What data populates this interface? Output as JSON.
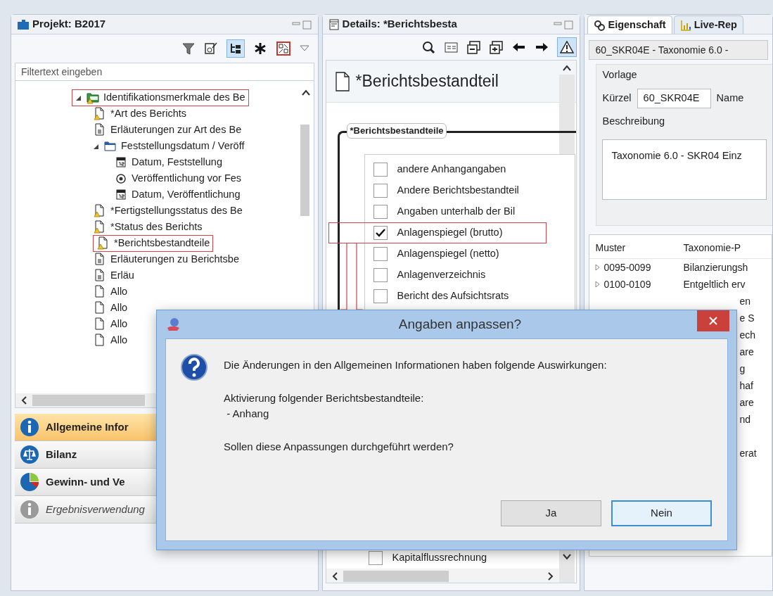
{
  "project_panel": {
    "title": "Projekt: B2017",
    "filter": {
      "placeholder": "Filtertext eingeben"
    },
    "tree": [
      {
        "label": "Identifikationsmerkmale des Be",
        "kind": "folder-green",
        "warning": true,
        "expanded": true,
        "marked": true,
        "children": [
          {
            "label": "*Art des Berichts",
            "kind": "doc",
            "warning": true,
            "marked": false
          },
          {
            "label": "Erläuterungen zur Art des Be",
            "kind": "doc-text",
            "warning": false,
            "marked": false
          },
          {
            "label": "Feststellungsdatum / Veröff",
            "kind": "folder",
            "warning": false,
            "expanded": true,
            "marked": false,
            "children": [
              {
                "label": "Datum, Feststellung",
                "kind": "calendar",
                "warning": false,
                "marked": false
              },
              {
                "label": "Veröffentlichung vor Fes",
                "kind": "radio",
                "warning": false,
                "marked": false
              },
              {
                "label": "Datum, Veröffentlichung",
                "kind": "calendar",
                "warning": false,
                "marked": false
              }
            ]
          },
          {
            "label": "*Fertigstellungsstatus des Be",
            "kind": "doc",
            "warning": true,
            "marked": false
          },
          {
            "label": "*Status des Berichts",
            "kind": "doc",
            "warning": true,
            "marked": false
          },
          {
            "label": "*Berichtsbestandteile",
            "kind": "doc",
            "warning": true,
            "marked": true
          },
          {
            "label": "Erläuterungen zu Berichtsbe",
            "kind": "doc-text",
            "warning": false,
            "marked": false
          },
          {
            "label": "Erläu",
            "kind": "doc-text",
            "warning": false,
            "marked": false
          },
          {
            "label": "Allo",
            "kind": "doc",
            "warning": false,
            "marked": false
          },
          {
            "label": "Allo",
            "kind": "doc",
            "warning": false,
            "marked": false
          },
          {
            "label": "Allo",
            "kind": "doc",
            "warning": false,
            "marked": false
          },
          {
            "label": "Allo",
            "kind": "doc",
            "warning": false,
            "marked": false
          }
        ]
      }
    ],
    "sections": [
      {
        "label": "Allgemeine Infor",
        "kind": "info",
        "selected": true,
        "disabled": false
      },
      {
        "label": "Bilanz",
        "kind": "scale",
        "selected": false,
        "disabled": false
      },
      {
        "label": "Gewinn- und Ve",
        "kind": "pie",
        "selected": false,
        "disabled": false
      },
      {
        "label": "Ergebnisverwendung",
        "kind": "info",
        "selected": false,
        "disabled": true
      }
    ]
  },
  "details_panel": {
    "title": "Details: *Berichtsbesta",
    "heading": "*Berichtsbestandteil",
    "group_title": "*Berichtsbestandteile",
    "items": [
      {
        "label": "andere Anhangangaben",
        "checked": false,
        "marked": false
      },
      {
        "label": "Andere Berichtsbestandteil",
        "checked": false,
        "marked": false
      },
      {
        "label": "Angaben unterhalb der Bil",
        "checked": false,
        "marked": false
      },
      {
        "label": "Anlagenspiegel (brutto)",
        "checked": true,
        "marked": true
      },
      {
        "label": "Anlagenspiegel (netto)",
        "checked": false,
        "marked": false
      },
      {
        "label": "Anlagenverzeichnis",
        "checked": false,
        "marked": false
      },
      {
        "label": "Bericht des Aufsichtsrats",
        "checked": false,
        "marked": false
      }
    ],
    "last_item": {
      "label": "Kapitalflussrechnung",
      "checked": false
    }
  },
  "properties_panel": {
    "tabs": [
      {
        "label": "Eigenschaft",
        "selected": true
      },
      {
        "label": "Live-Rep",
        "selected": false
      }
    ],
    "template_select": "60_SKR04E - Taxonomie 6.0 -",
    "group_title": "Vorlage",
    "short_label": "Kürzel",
    "short_value": "60_SKR04E",
    "name_label": "Name",
    "description_label": "Beschreibung",
    "description_value": "Taxonomie 6.0 - SKR04 Einz",
    "table": {
      "columns": [
        "Muster",
        "Taxonomie-P"
      ],
      "rows": [
        {
          "pattern": "0095-0099",
          "name": "Bilanzierungsh"
        },
        {
          "pattern": "0100-0109",
          "name": "Entgeltlich erv"
        },
        {
          "name": "en"
        },
        {
          "name": "e S"
        },
        {
          "name": "ech"
        },
        {
          "name": "are"
        },
        {
          "name": "g"
        },
        {
          "name": "haf"
        },
        {
          "name": "are"
        },
        {
          "name": "nd"
        },
        {
          "name": ""
        },
        {
          "name": "erat"
        }
      ]
    }
  },
  "dialog": {
    "title": "Angaben anpassen?",
    "lines": [
      "Die Änderungen in den Allgemeinen Informationen haben folgende Auswirkungen:",
      "Aktivierung folgender Berichtsbestandteile:",
      " - Anhang",
      "Sollen diese Anpassungen durchgeführt werden?"
    ],
    "buttons": [
      {
        "label": "Ja",
        "focused": false
      },
      {
        "label": "Nein",
        "focused": true
      }
    ]
  }
}
